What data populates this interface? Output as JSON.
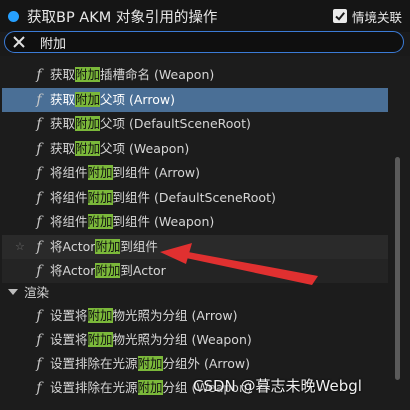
{
  "header": {
    "title": "获取BP AKM 对象引用的操作",
    "context_label": "情境关联",
    "context_checked": true
  },
  "search": {
    "value": "附加",
    "placeholder": ""
  },
  "rows": [
    {
      "pre": "获取",
      "hl": "附加",
      "post": "插槽命名 (Weapon)"
    },
    {
      "pre": "获取",
      "hl": "附加",
      "post": "父项 (Arrow)",
      "state": "selected"
    },
    {
      "pre": "获取",
      "hl": "附加",
      "post": "父项 (DefaultSceneRoot)"
    },
    {
      "pre": "获取",
      "hl": "附加",
      "post": "父项 (Weapon)"
    },
    {
      "pre": "将组件",
      "hl": "附加",
      "post": "到组件 (Arrow)"
    },
    {
      "pre": "将组件",
      "hl": "附加",
      "post": "到组件 (DefaultSceneRoot)"
    },
    {
      "pre": "将组件",
      "hl": "附加",
      "post": "到组件 (Weapon)"
    },
    {
      "pre": "将Actor",
      "hl": "附加",
      "post": "到组件",
      "state": "hovered",
      "star": true
    },
    {
      "pre": "将Actor",
      "hl": "附加",
      "post": "到Actor",
      "state": "dim"
    }
  ],
  "category": {
    "label": "渲染"
  },
  "rows2": [
    {
      "pre": "设置将",
      "hl": "附加",
      "post": "物光照为分组 (Arrow)"
    },
    {
      "pre": "设置将",
      "hl": "附加",
      "post": "物光照为分组 (Weapon)"
    },
    {
      "pre": "设置排除在光源",
      "hl": "附加",
      "post": "分组外 (Arrow)"
    },
    {
      "pre": "设置排除在光源",
      "hl": "附加",
      "post": "分组 (Weapon)"
    }
  ],
  "icons": {
    "function": "f",
    "star": "☆"
  },
  "colors": {
    "selection": "#4a6f96",
    "highlight": "#7bb83a",
    "accent": "#26a0ff",
    "annotation": "#e03030"
  },
  "watermark": "CSDN @暮志未晚Webgl"
}
